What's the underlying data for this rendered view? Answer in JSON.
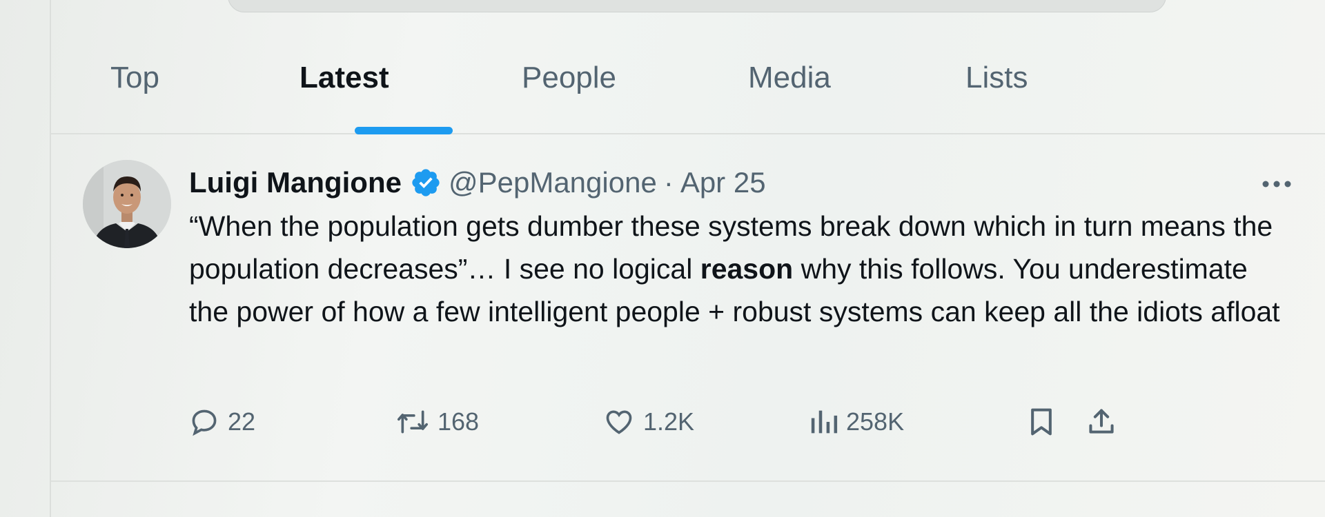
{
  "tabs": [
    {
      "label": "Top",
      "active": false
    },
    {
      "label": "Latest",
      "active": true
    },
    {
      "label": "People",
      "active": false
    },
    {
      "label": "Media",
      "active": false
    },
    {
      "label": "Lists",
      "active": false
    }
  ],
  "tweet": {
    "display_name": "Luigi Mangione",
    "handle": "@PepMangione",
    "separator": "·",
    "date": "Apr 25",
    "text_part1": "“When the population gets dumber these systems break down which in turn means the population decreases”… I see no logical ",
    "text_bold": "reason",
    "text_part2": " why this follows. You underestimate the power of how a few intelligent people + robust systems can keep all the idiots afloat",
    "stats": {
      "replies": "22",
      "reposts": "168",
      "likes": "1.2K",
      "views": "258K"
    }
  },
  "icons": {
    "verified": "verified-badge-icon",
    "more": "more-dots-icon",
    "reply": "reply-icon",
    "repost": "repost-icon",
    "like": "heart-icon",
    "views": "analytics-icon",
    "bookmark": "bookmark-icon",
    "share": "share-icon"
  },
  "colors": {
    "accent": "#1d9bf0",
    "text_primary": "#0f1419",
    "text_secondary": "#536471"
  }
}
